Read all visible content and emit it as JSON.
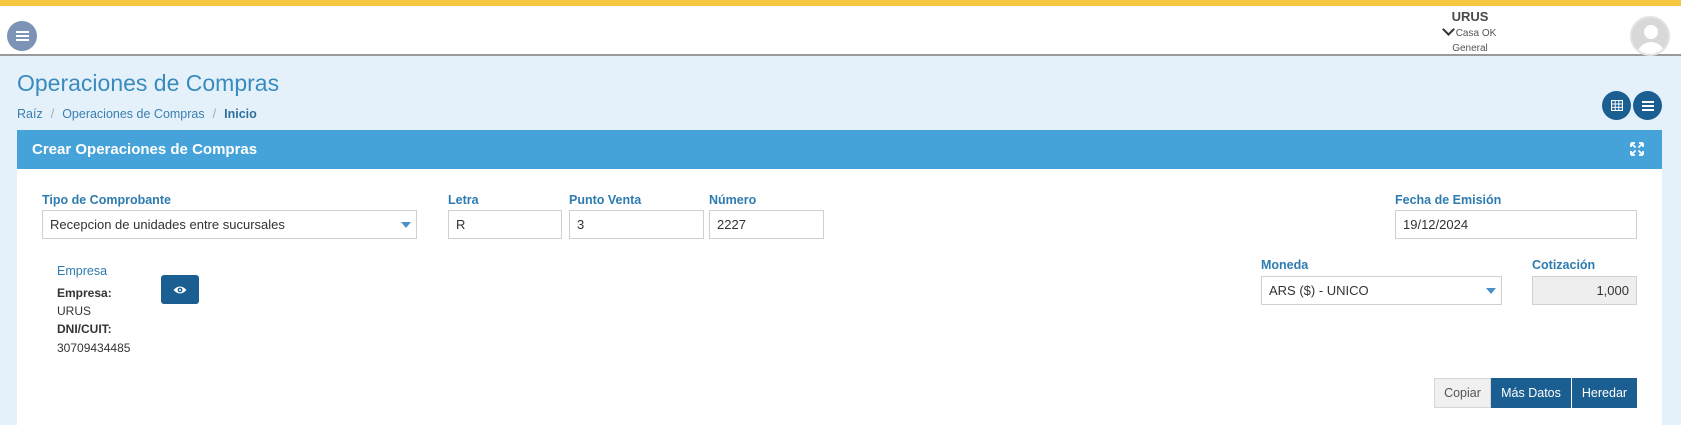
{
  "header": {
    "company": "URUS",
    "branch": "Casa OK",
    "sub": "General"
  },
  "page": {
    "title": "Operaciones de Compras",
    "breadcrumb": [
      "Raíz",
      "Operaciones de Compras",
      "Inicio"
    ]
  },
  "card": {
    "title": "Crear Operaciones de Compras"
  },
  "form": {
    "tipo_label": "Tipo de Comprobante",
    "tipo_value": "Recepcion de unidades entre sucursales",
    "letra_label": "Letra",
    "letra_value": "R",
    "punto_label": "Punto Venta",
    "punto_value": "3",
    "numero_label": "Número",
    "numero_value": "2227",
    "fecha_label": "Fecha de Emisión",
    "fecha_value": "19/12/2024",
    "moneda_label": "Moneda",
    "moneda_value": "ARS ($) - UNICO",
    "cotizacion_label": "Cotización",
    "cotizacion_value": "1,000"
  },
  "empresa": {
    "title": "Empresa",
    "empresa_label": "Empresa:",
    "empresa_value": "URUS",
    "dni_label": "DNI/CUIT:",
    "dni_value": "30709434485"
  },
  "buttons": {
    "copiar": "Copiar",
    "mas_datos": "Más Datos",
    "heredar": "Heredar"
  },
  "colors": {
    "accent_yellow": "#f6c840",
    "header_blue": "#45a3d9",
    "button_dark": "#1b5e92"
  }
}
